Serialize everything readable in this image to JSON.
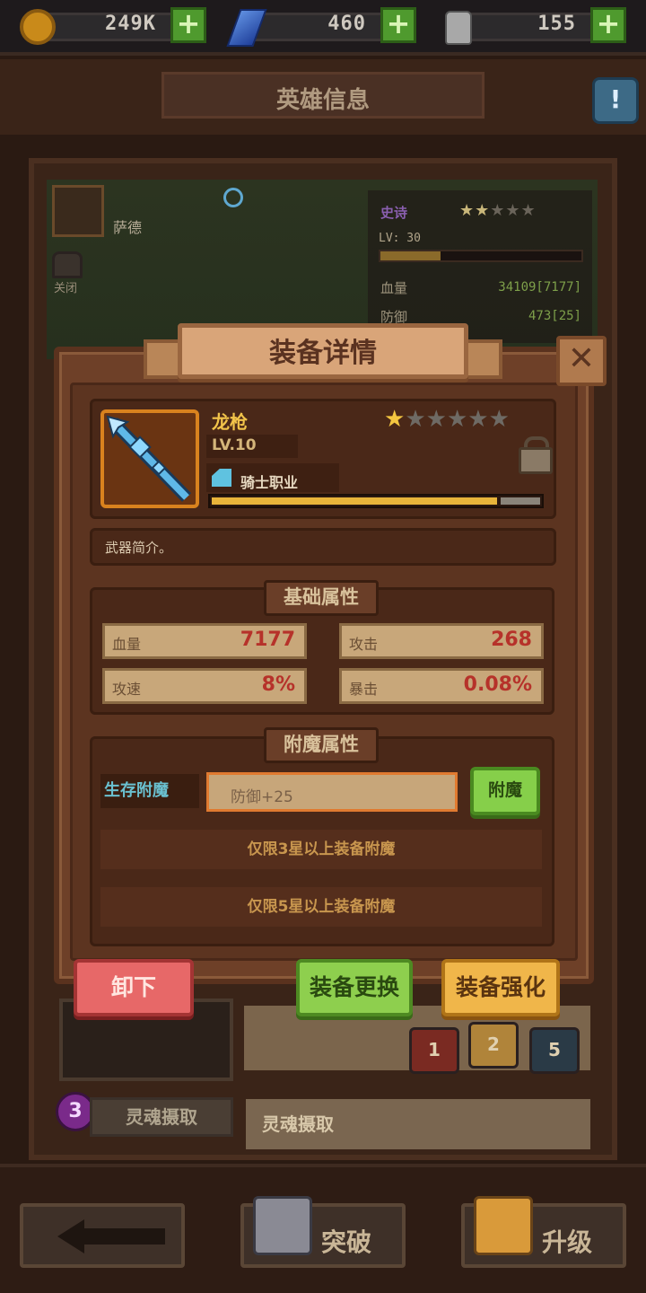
{
  "currency": {
    "coins": "249K",
    "gems": "460",
    "potions": "155",
    "add_label": "+"
  },
  "header": {
    "title": "英雄信息",
    "help_label": "!"
  },
  "hero": {
    "name": "萨德",
    "lock_label": "关闭",
    "rarity": "史诗",
    "level": "LV: 30",
    "stats": [
      {
        "label": "血量",
        "value": "34109[7177]"
      },
      {
        "label": "防御",
        "value": "473[25]"
      }
    ]
  },
  "modal": {
    "title": "装备详情",
    "close_label": "✕",
    "item": {
      "name": "龙枪",
      "level": "LV.10",
      "class": "骑士职业",
      "stars_total": 6,
      "stars_filled": 1,
      "star_glyph": "★",
      "xp_progress": 0.87,
      "description": "武器简介。"
    },
    "base_section": {
      "title": "基础属性",
      "stats": [
        {
          "label": "血量",
          "value": "7177"
        },
        {
          "label": "攻击",
          "value": "268"
        },
        {
          "label": "攻速",
          "value": "8%"
        },
        {
          "label": "暴击",
          "value": "0.08%"
        }
      ]
    },
    "enchant_section": {
      "title": "附魔属性",
      "type": "生存附魔",
      "value": "防御+25",
      "button": "附魔",
      "locked_rows": [
        "仅限3星以上装备附魔",
        "仅限5星以上装备附魔"
      ]
    },
    "buttons": {
      "unequip": "卸下",
      "change": "装备更换",
      "enhance": "装备强化"
    }
  },
  "lower": {
    "tiers": [
      "1",
      "2",
      "5"
    ],
    "soul_badge": "3",
    "soul_button": "灵魂摄取",
    "soul_field": "灵魂摄取"
  },
  "bottom_nav": {
    "breakthrough": "突破",
    "upgrade": "升级"
  },
  "colors": {
    "accent_gold": "#f2c44a",
    "stat_value": "#b6322a",
    "enchant_blue": "#6ac0d0"
  },
  "icons": [
    "coin-icon",
    "gem-icon",
    "potion-icon",
    "help-icon",
    "magnifier-icon",
    "lock-icon",
    "spear-icon",
    "knight-class-icon",
    "back-arrow-icon",
    "helmet-icon",
    "book-icon"
  ]
}
